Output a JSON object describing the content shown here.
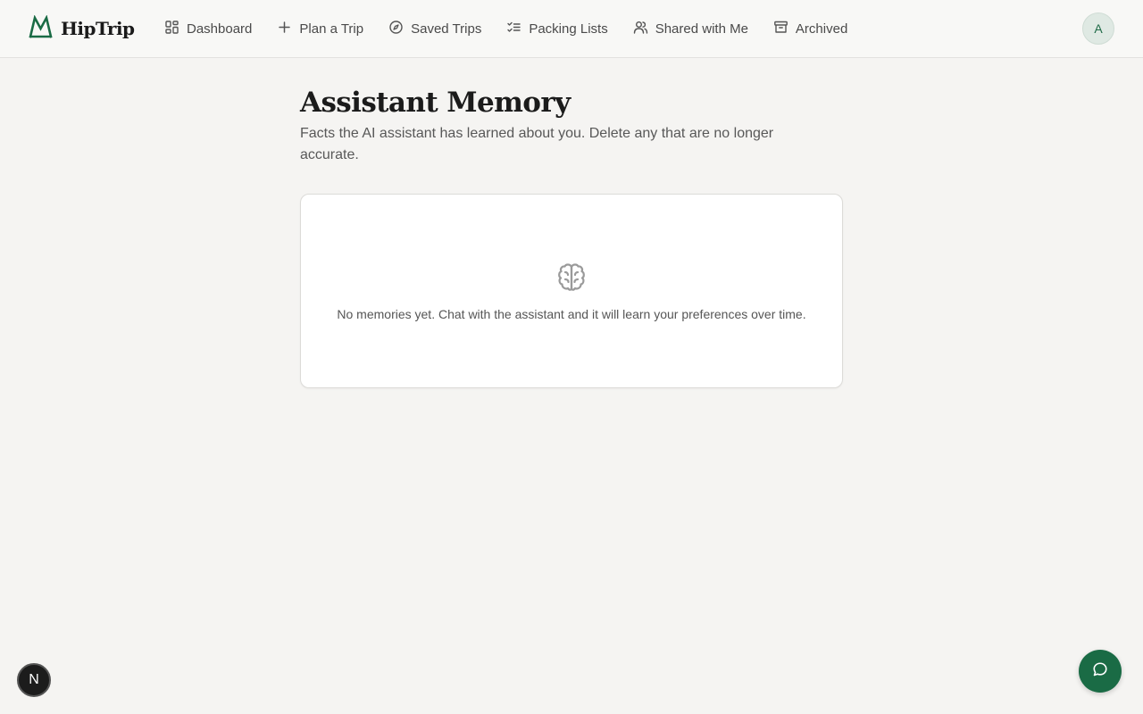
{
  "app": {
    "brand_name": "HipTrip",
    "brand_icon": "mountain-icon",
    "accent_color": "#1a6b45"
  },
  "nav": {
    "items": [
      {
        "label": "Dashboard",
        "icon": "grid-icon"
      },
      {
        "label": "Plan a Trip",
        "icon": "plus-icon"
      },
      {
        "label": "Saved Trips",
        "icon": "compass-icon"
      },
      {
        "label": "Packing Lists",
        "icon": "checklist-icon"
      },
      {
        "label": "Shared with Me",
        "icon": "users-icon"
      },
      {
        "label": "Archived",
        "icon": "archive-icon"
      }
    ]
  },
  "user": {
    "avatar_initial": "A"
  },
  "page": {
    "title": "Assistant Memory",
    "subtitle": "Facts the AI assistant has learned about you. Delete any that are no longer accurate."
  },
  "empty_state": {
    "icon": "brain-icon",
    "message": "No memories yet. Chat with the assistant and it will learn your preferences over time."
  },
  "floating": {
    "dev_badge_label": "N",
    "chat_button_icon": "chat-bubble-icon"
  }
}
